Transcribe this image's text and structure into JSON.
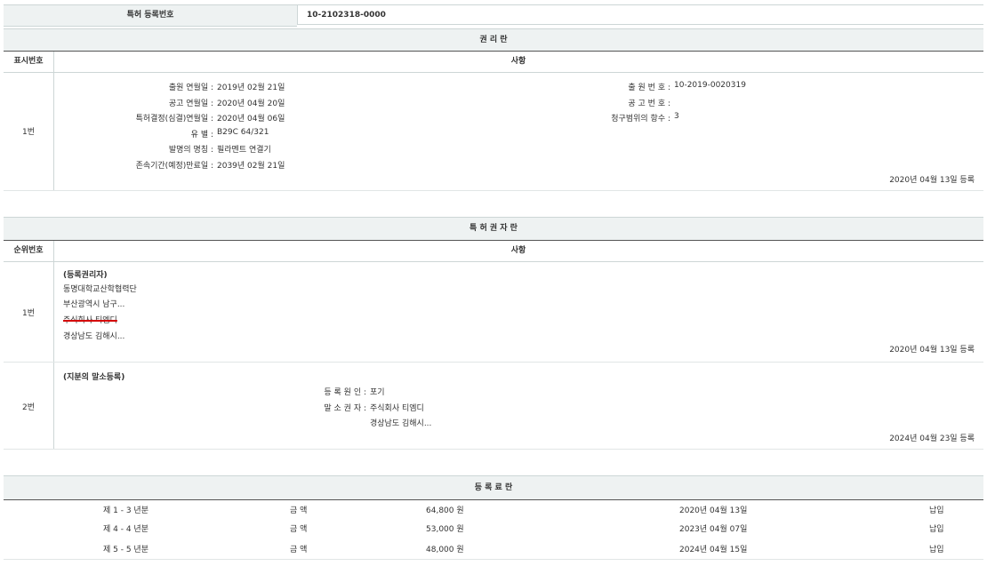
{
  "reg": {
    "label": "특허 등록번호",
    "value": "10-2102318-0000"
  },
  "rights_section": {
    "title": "권 리 란",
    "col_num": "표시번호",
    "col_item": "사항",
    "row_num": "1번",
    "left": [
      {
        "label": "출원 연월일 :",
        "value": "2019년 02월 21일"
      },
      {
        "label": "공고 연월일 :",
        "value": "2020년 04월 20일"
      },
      {
        "label": "특허결정(심결)연월일 :",
        "value": "2020년 04월 06일"
      },
      {
        "label": "유 별 :",
        "value": "B29C 64/321"
      },
      {
        "label": "발명의 명칭 :",
        "value": "필라멘트 연결기"
      },
      {
        "label": "존속기간(예정)만료일 :",
        "value": "2039년 02월 21일"
      }
    ],
    "right": [
      {
        "label": "출 원 번 호 :",
        "value": "10-2019-0020319"
      },
      {
        "label": "공 고 번 호 :",
        "value": ""
      },
      {
        "label": "청구범위의 항수 :",
        "value": "3"
      }
    ],
    "reg_date": "2020년 04월 13일 등록"
  },
  "holder_section": {
    "title": "특 허 권 자 란",
    "col_num": "순위번호",
    "col_item": "사항",
    "rows": [
      {
        "num": "1번",
        "heading": "(등록권리자)",
        "lines": [
          "동명대학교산학협력단",
          "부산광역시 남구...",
          "주식회사 티엠디",
          "경상남도 김해시..."
        ],
        "date": "2020년 04월 13일 등록"
      },
      {
        "num": "2번",
        "heading": "(지분의 말소등록)",
        "cause_label": "등 록 원 인 :",
        "cause_value": "포기",
        "holder_label": "말 소 권 자 :",
        "holder_value": "주식회사 티엠디",
        "holder_addr": "경상남도 김해시...",
        "date": "2024년 04월 23일 등록"
      }
    ]
  },
  "fee_section": {
    "title": "등 록 료 란",
    "rows": [
      {
        "period": "제 1 - 3 년분",
        "label": "금 액",
        "amount": "64,800 원",
        "date": "2020년 04월 13일",
        "status": "납입"
      },
      {
        "period": "제 4 - 4 년분",
        "label": "금 액",
        "amount": "53,000 원",
        "date": "2023년 04월 07일",
        "status": "납입"
      },
      {
        "period": "제 5 - 5 년분",
        "label": "금 액",
        "amount": "48,000 원",
        "date": "2024년 04월 15일",
        "status": "납입"
      }
    ]
  }
}
